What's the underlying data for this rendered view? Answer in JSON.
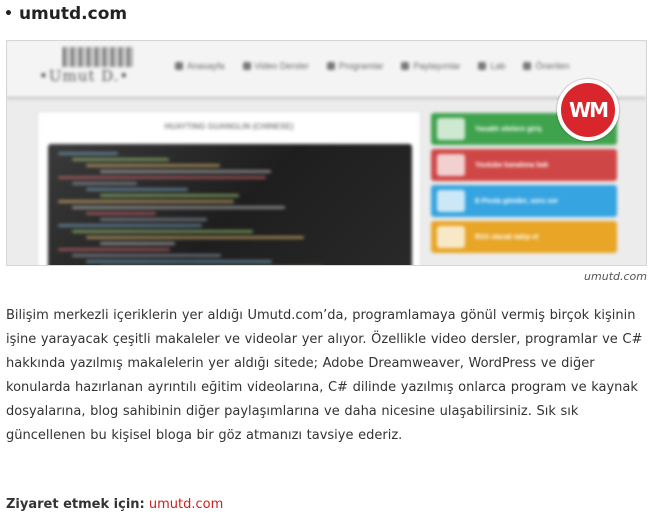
{
  "heading": {
    "bullet": "•",
    "title": "umutd.com"
  },
  "screenshot": {
    "logo_text": "•Umut D.•",
    "nav": [
      {
        "icon": "home-icon",
        "label": "Anasayfa"
      },
      {
        "icon": "video-icon",
        "label": "Video Dersler"
      },
      {
        "icon": "power-icon",
        "label": "Programlar"
      },
      {
        "icon": "share-icon",
        "label": "Paylaşımlar"
      },
      {
        "icon": "flask-icon",
        "label": "Lab"
      },
      {
        "icon": "gear-icon",
        "label": "Önerilen"
      }
    ],
    "article_title": "HUAYTING GUANGLIN (CHINESE)",
    "widgets": [
      {
        "icon": "check-icon",
        "label": "Yasaklı sitelere giriş",
        "color": "#3fa34d"
      },
      {
        "icon": "youtube-icon",
        "label": "Youtube kanalıma bak",
        "color": "#cf4646"
      },
      {
        "icon": "mail-icon",
        "label": "E-Posta gönder, soru sor",
        "color": "#35a4e0"
      },
      {
        "icon": "rss-icon",
        "label": "RSS olarak takip et",
        "color": "#e8a526"
      }
    ],
    "badge_text": "WM",
    "badge_color": "#d9262c"
  },
  "caption": "umutd.com",
  "description": "Bilişim merkezli içeriklerin yer aldığı Umutd.com’da, programlamaya gönül vermiş birçok kişinin işine yarayacak çeşitli makaleler ve videolar yer alıyor. Özellikle video dersler, programlar ve C# hakkında yazılmış makalelerin yer aldığı sitede; Adobe Dreamweaver, WordPress ve diğer konularda hazırlanan ayrıntılı eğitim videolarına, C# dilinde yazılmış onlarca program ve kaynak dosyalarına, blog sahibinin diğer paylaşımlarına ve daha nicesine ulaşabilirsiniz. Sık sık güncellenen bu kişisel bloga bir göz atmanızı tavsiye ederiz.",
  "visit": {
    "label": "Ziyaret etmek için:",
    "link_text": "umutd.com"
  },
  "colors": {
    "link": "#cc1f1f",
    "text": "#333333"
  }
}
